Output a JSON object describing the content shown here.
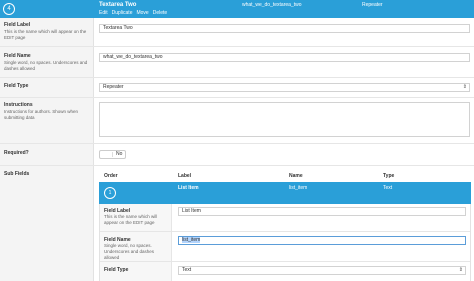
{
  "header": {
    "number": "4",
    "title": "Textarea Two",
    "actions": [
      "Edit",
      "Duplicate",
      "Move",
      "Delete"
    ],
    "name": "what_we_do_textarea_two",
    "type": "Repeater"
  },
  "fields": {
    "label": {
      "title": "Field Label",
      "desc": "This is the name which will appear on the EDIT page",
      "value": "Textarea Two"
    },
    "name": {
      "title": "Field Name",
      "desc": "Single word, no spaces. Underscores and dashes allowed",
      "value": "what_we_do_textarea_two"
    },
    "type": {
      "title": "Field Type",
      "value": "Repeater"
    },
    "instructions": {
      "title": "Instructions",
      "desc": "Instructions for authors. Shown when submitting data"
    },
    "required": {
      "title": "Required?",
      "toggle": "No"
    },
    "sub_fields": {
      "title": "Sub Fields"
    }
  },
  "sub_table": {
    "columns": [
      "Order",
      "Label",
      "Name",
      "Type"
    ],
    "row": {
      "order": "1",
      "label": "List Item",
      "name": "list_item",
      "type": "Text"
    }
  },
  "sub_edit": {
    "label": {
      "title": "Field Label",
      "desc": "This is the name which will appear on the EDIT page",
      "value": "List Item"
    },
    "name": {
      "title": "Field Name",
      "desc": "Single word, no spaces. Underscores and dashes allowed",
      "value": "list_item"
    },
    "type": {
      "title": "Field Type",
      "value": "Text"
    }
  },
  "colors": {
    "accent": "#2a9fd8",
    "sidebar": "#f4f4f4"
  }
}
